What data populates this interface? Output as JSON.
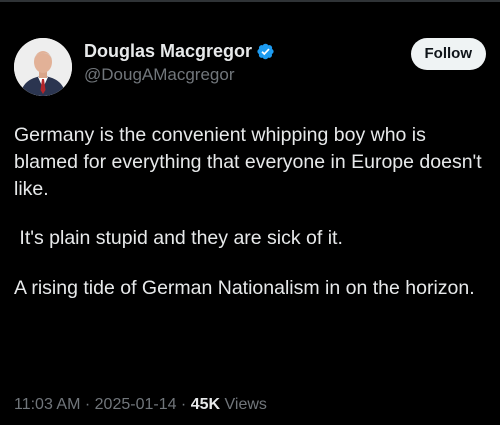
{
  "author": {
    "display_name": "Douglas Macgregor",
    "handle": "@DougAMacgregor",
    "verified": true
  },
  "follow_button": {
    "label": "Follow"
  },
  "post": {
    "paragraphs": [
      "Germany is the convenient whipping boy who is blamed for everything that everyone in Europe doesn't like.",
      " It's plain stupid and they are sick of it.",
      "A rising tide of German Nationalism in on the horizon."
    ]
  },
  "meta": {
    "time": "11:03 AM",
    "separator": " · ",
    "date": "2025-01-14",
    "views_count": "45K",
    "views_label": " Views"
  },
  "colors": {
    "background": "#000000",
    "text": "#e7e9ea",
    "secondary_text": "#71767b",
    "verified": "#1d9bf0",
    "follow_bg": "#eff3f4"
  }
}
